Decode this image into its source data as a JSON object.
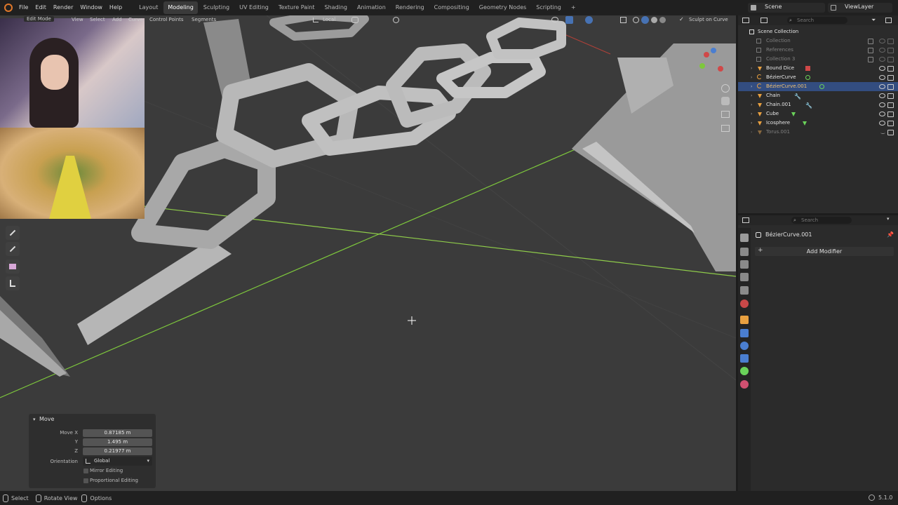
{
  "topbar": {
    "menus": [
      "File",
      "Edit",
      "Render",
      "Window",
      "Help"
    ],
    "workspaces": [
      "Layout",
      "Modeling",
      "Sculpting",
      "UV Editing",
      "Texture Paint",
      "Shading",
      "Animation",
      "Rendering",
      "Compositing",
      "Geometry Nodes",
      "Scripting"
    ],
    "active_workspace": "Modeling",
    "add_tab": "+",
    "scene": "Scene",
    "view_layer": "ViewLayer"
  },
  "viewport_header": {
    "mode": "Edit Mode",
    "items": [
      "View",
      "Select",
      "Add",
      "Curve"
    ],
    "control_points": "Control Points",
    "segments": "Segments",
    "transform_orientation": "Local",
    "sculpt_on_curve": "Sculpt on Curve"
  },
  "outliner": {
    "search_placeholder": "Search",
    "root": "Scene Collection",
    "items": [
      {
        "label": "Collection",
        "type": "collection",
        "dim": true
      },
      {
        "label": "References",
        "type": "collection",
        "dim": true
      },
      {
        "label": "Collection 3",
        "type": "collection",
        "dim": true
      },
      {
        "label": "Bound Dice",
        "type": "object",
        "dim": false
      },
      {
        "label": "BézierCurve",
        "type": "curve",
        "dim": false
      },
      {
        "label": "BézierCurve.001",
        "type": "curve",
        "dim": false,
        "selected": true
      },
      {
        "label": "Chain",
        "type": "mesh",
        "dim": false
      },
      {
        "label": "Chain.001",
        "type": "mesh",
        "dim": false
      },
      {
        "label": "Cube",
        "type": "mesh",
        "dim": false
      },
      {
        "label": "Icosphere",
        "type": "mesh",
        "dim": false
      },
      {
        "label": "Torus.001",
        "type": "mesh",
        "dim": true
      }
    ]
  },
  "properties": {
    "search_placeholder": "Search",
    "object_name": "BézierCurve.001",
    "add_modifier": "Add Modifier"
  },
  "move_panel": {
    "title": "Move",
    "move_x_label": "Move X",
    "y_label": "Y",
    "z_label": "Z",
    "x": "0.87185 m",
    "y": "1.495 m",
    "z": "0.21977 m",
    "orientation_label": "Orientation",
    "orientation": "Global",
    "mirror_editing": "Mirror Editing",
    "proportional_editing": "Proportional Editing"
  },
  "statusbar": {
    "select": "Select",
    "rotate_view": "Rotate View",
    "options": "Options",
    "version": "5.1.0"
  },
  "colors": {
    "accent": "#4772b3",
    "selection": "#334d80",
    "y_axis": "#7ec83c",
    "x_axis": "#c8483c",
    "viewport_bg": "#3b3b3b",
    "object_orange": "#e8a040",
    "curve_green": "#6ad25a"
  }
}
